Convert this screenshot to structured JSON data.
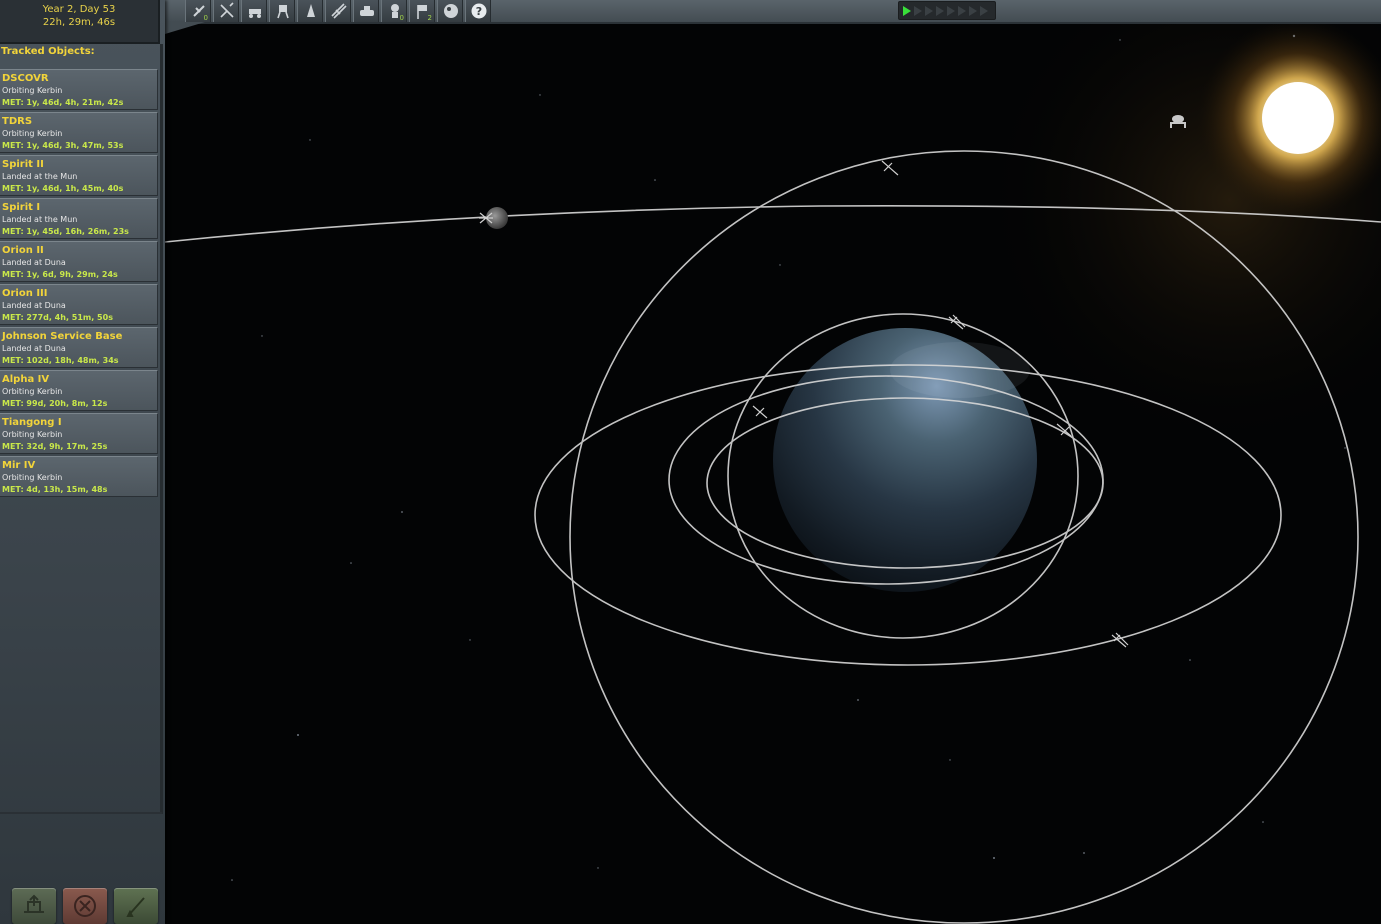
{
  "clock": {
    "date": "Year 2, Day 53",
    "time": "22h, 29m, 46s"
  },
  "tracked": {
    "header": "Tracked Objects:",
    "vessels": [
      {
        "name": "DSCOVR",
        "status": "Orbiting Kerbin",
        "met": "MET: 1y, 46d, 4h, 21m, 42s"
      },
      {
        "name": "TDRS",
        "status": "Orbiting Kerbin",
        "met": "MET: 1y, 46d, 3h, 47m, 53s"
      },
      {
        "name": "Spirit II",
        "status": "Landed at the Mun",
        "met": "MET: 1y, 46d, 1h, 45m, 40s"
      },
      {
        "name": "Spirit I",
        "status": "Landed at the Mun",
        "met": "MET: 1y, 45d, 16h, 26m, 23s"
      },
      {
        "name": "Orion II",
        "status": "Landed at Duna",
        "met": "MET: 1y, 6d, 9h, 29m, 24s"
      },
      {
        "name": "Orion III",
        "status": "Landed at Duna",
        "met": "MET: 277d, 4h, 51m, 50s"
      },
      {
        "name": "Johnson Service Base",
        "status": "Landed at Duna",
        "met": "MET: 102d, 18h, 48m, 34s"
      },
      {
        "name": "Alpha IV",
        "status": "Orbiting Kerbin",
        "met": "MET: 99d, 20h, 8m, 12s"
      },
      {
        "name": "Tiangong I",
        "status": "Orbiting Kerbin",
        "met": "MET: 32d, 9h, 17m, 25s"
      },
      {
        "name": "Mir IV",
        "status": "Orbiting Kerbin",
        "met": "MET: 4d, 13h, 15m, 48s"
      }
    ]
  },
  "toolbar": {
    "filters": [
      {
        "icon": "debris-filter-icon",
        "count": "0"
      },
      {
        "icon": "probe-filter-icon",
        "count": ""
      },
      {
        "icon": "rover-filter-icon",
        "count": ""
      },
      {
        "icon": "lander-filter-icon",
        "count": ""
      },
      {
        "icon": "ship-filter-icon",
        "count": ""
      },
      {
        "icon": "station-filter-icon",
        "count": ""
      },
      {
        "icon": "base-filter-icon",
        "count": ""
      },
      {
        "icon": "eva-filter-icon",
        "count": "0"
      },
      {
        "icon": "flag-filter-icon",
        "count": "2"
      },
      {
        "icon": "unknown-object-filter-icon",
        "count": ""
      },
      {
        "icon": "help-icon",
        "count": ""
      }
    ],
    "warp": {
      "active_steps": 1,
      "total_steps": 8
    }
  },
  "bottom_buttons": {
    "recover": "recover-vessel-icon",
    "terminate": "terminate-vessel-icon",
    "fly": "fly-vessel-icon"
  },
  "colors": {
    "name": "#f2d43a",
    "met": "#c9e84a",
    "orbit": "#d8d8d8"
  }
}
